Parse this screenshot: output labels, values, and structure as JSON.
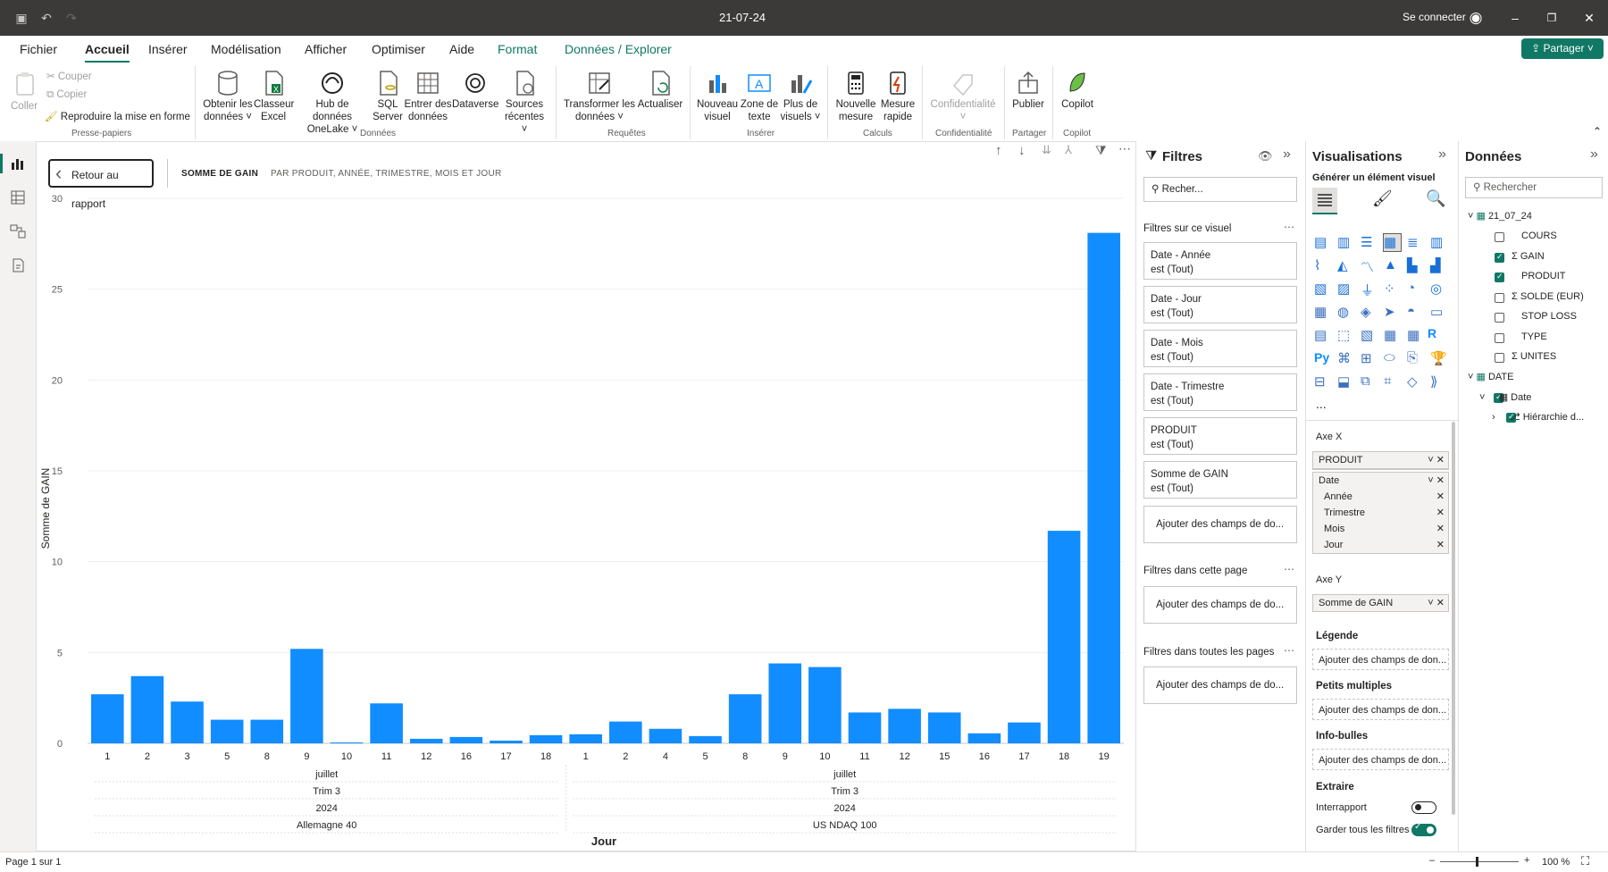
{
  "window": {
    "title": "21-07-24",
    "sign_in": "Se connecter"
  },
  "menu": {
    "items": [
      "Fichier",
      "Accueil",
      "Insérer",
      "Modélisation",
      "Afficher",
      "Optimiser",
      "Aide",
      "Format",
      "Données / Explorer"
    ],
    "share": "Partager"
  },
  "ribbon": {
    "clipboard": {
      "paste": "Coller",
      "cut": "Couper",
      "copy": "Copier",
      "format_painter": "Reproduire la mise en forme",
      "group": "Presse-papiers"
    },
    "data": {
      "get_data": "Obtenir les données",
      "excel": "Classeur Excel",
      "onelake": "Hub de données OneLake",
      "sql": "SQL Server",
      "enter": "Entrer des données",
      "dataverse": "Dataverse",
      "recent": "Sources récentes",
      "group": "Données"
    },
    "queries": {
      "transform": "Transformer les données",
      "refresh": "Actualiser",
      "group": "Requêtes"
    },
    "insert": {
      "new_visual": "Nouveau visuel",
      "textbox": "Zone de texte",
      "more_visuals": "Plus de visuels",
      "group": "Insérer"
    },
    "calc": {
      "new_measure": "Nouvelle mesure",
      "quick_measure": "Mesure rapide",
      "group": "Calculs"
    },
    "sensitivity": {
      "label": "Confidentialité",
      "group": "Confidentialité"
    },
    "share": {
      "publish": "Publier",
      "group": "Partager"
    },
    "copilot": {
      "label": "Copilot",
      "group": "Copilot"
    }
  },
  "canvas": {
    "back_button": "Retour au rapport",
    "header_measure": "SOMME DE GAIN",
    "header_by": "PAR PRODUIT, ANNÉE, TRIMESTRE, MOIS ET JOUR"
  },
  "chart_data": {
    "type": "bar",
    "ylabel": "Somme de GAIN",
    "xlabel": "Jour",
    "ylim": [
      0,
      30
    ],
    "yticks": [
      0,
      5,
      10,
      15,
      20,
      25,
      30
    ],
    "color": "#118DFF",
    "groups": [
      {
        "product": "Allemagne 40",
        "year": "2024",
        "quarter": "Trim 3",
        "month": "juillet",
        "categories": [
          "1",
          "2",
          "3",
          "5",
          "8",
          "9",
          "10",
          "11",
          "12",
          "16",
          "17",
          "18"
        ],
        "values": [
          2.7,
          3.7,
          2.3,
          1.3,
          1.3,
          5.2,
          0.05,
          2.2,
          0.25,
          0.35,
          0.15,
          0.45
        ]
      },
      {
        "product": "US NDAQ 100",
        "year": "2024",
        "quarter": "Trim 3",
        "month": "juillet",
        "categories": [
          "1",
          "2",
          "4",
          "5",
          "8",
          "9",
          "10",
          "11",
          "12",
          "15",
          "16",
          "17",
          "18",
          "19"
        ],
        "values": [
          0.5,
          1.2,
          0.8,
          0.4,
          2.7,
          4.4,
          4.2,
          1.7,
          1.9,
          1.7,
          0.55,
          1.15,
          11.7,
          28.1
        ]
      }
    ]
  },
  "filters": {
    "title": "Filtres",
    "search_placeholder": "Recher...",
    "on_visual": "Filtres sur ce visuel",
    "cards": [
      {
        "name": "Date - Année",
        "state": "est (Tout)"
      },
      {
        "name": "Date - Jour",
        "state": "est (Tout)"
      },
      {
        "name": "Date - Mois",
        "state": "est (Tout)"
      },
      {
        "name": "Date - Trimestre",
        "state": "est (Tout)"
      },
      {
        "name": "PRODUIT",
        "state": "est (Tout)"
      },
      {
        "name": "Somme de GAIN",
        "state": "est (Tout)"
      }
    ],
    "add_fields": "Ajouter des champs de do...",
    "on_page": "Filtres dans cette page",
    "on_all_pages": "Filtres dans toutes les pages"
  },
  "visualizations": {
    "title": "Visualisations",
    "build": "Générer un élément visuel",
    "axis_x": "Axe X",
    "x_fields": [
      "PRODUIT",
      "Date"
    ],
    "date_hierarchy": [
      "Année",
      "Trimestre",
      "Mois",
      "Jour"
    ],
    "axis_y": "Axe Y",
    "y_field": "Somme de GAIN",
    "legend": "Légende",
    "small_multiples": "Petits multiples",
    "tooltips": "Info-bulles",
    "add_fields": "Ajouter des champs de don...",
    "drillthrough": "Extraire",
    "cross_report": "Interrapport",
    "keep_filters": "Garder tous les filtres",
    "py": "Py",
    "r": "R",
    "more": "..."
  },
  "data_pane": {
    "title": "Données",
    "search_placeholder": "Rechercher",
    "table1": "21_07_24",
    "fields1": [
      {
        "name": "COURS",
        "sigma": false,
        "checked": false
      },
      {
        "name": "GAIN",
        "sigma": true,
        "checked": true
      },
      {
        "name": "PRODUIT",
        "sigma": false,
        "checked": true
      },
      {
        "name": "SOLDE (EUR)",
        "sigma": true,
        "checked": false
      },
      {
        "name": "STOP LOSS",
        "sigma": false,
        "checked": false
      },
      {
        "name": "TYPE",
        "sigma": false,
        "checked": false
      },
      {
        "name": "UNITES",
        "sigma": true,
        "checked": false
      }
    ],
    "table2": "DATE",
    "date_field": "Date",
    "hierarchy": "Hiérarchie d..."
  },
  "status": {
    "page": "Page 1 sur 1",
    "zoom": "100 %"
  }
}
